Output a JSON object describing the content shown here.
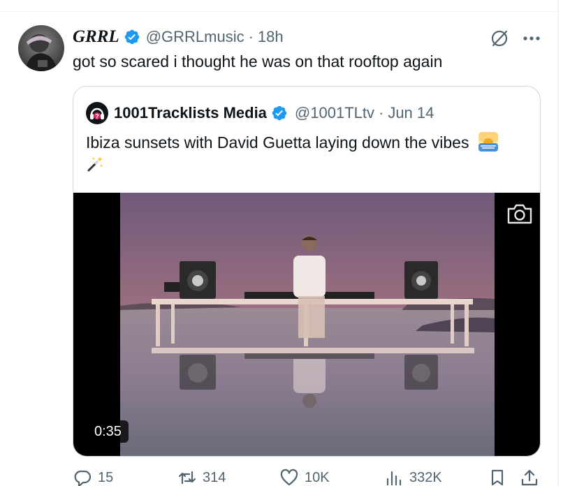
{
  "post": {
    "author_name": "GRRL",
    "handle": "@GRRLmusic",
    "separator": "·",
    "time": "18h",
    "text": "got so scared i thought he was on that rooftop again"
  },
  "quote": {
    "author_name": "1001Tracklists Media",
    "handle": "@1001TLtv",
    "separator": "·",
    "date": "Jun 14",
    "text": "Ibiza sunsets with David Guetta laying down the vibes",
    "video_duration": "0:35"
  },
  "actions": {
    "replies": "15",
    "reposts": "314",
    "likes": "10K",
    "views": "332K"
  },
  "icons": {
    "verified": "verified-badge-icon",
    "grok": "grok-icon",
    "more": "more-icon",
    "camera": "camera-icon",
    "reply": "reply-icon",
    "repost": "repost-icon",
    "like": "heart-icon",
    "views": "views-icon",
    "bookmark": "bookmark-icon",
    "share": "share-icon",
    "sunrise_emoji": "sunrise-emoji-icon",
    "magic_wand_emoji": "magic-wand-emoji-icon"
  },
  "colors": {
    "verified_blue": "#1d9bf0",
    "text_primary": "#0f1419",
    "text_secondary": "#536471",
    "border": "#cfd9de"
  }
}
